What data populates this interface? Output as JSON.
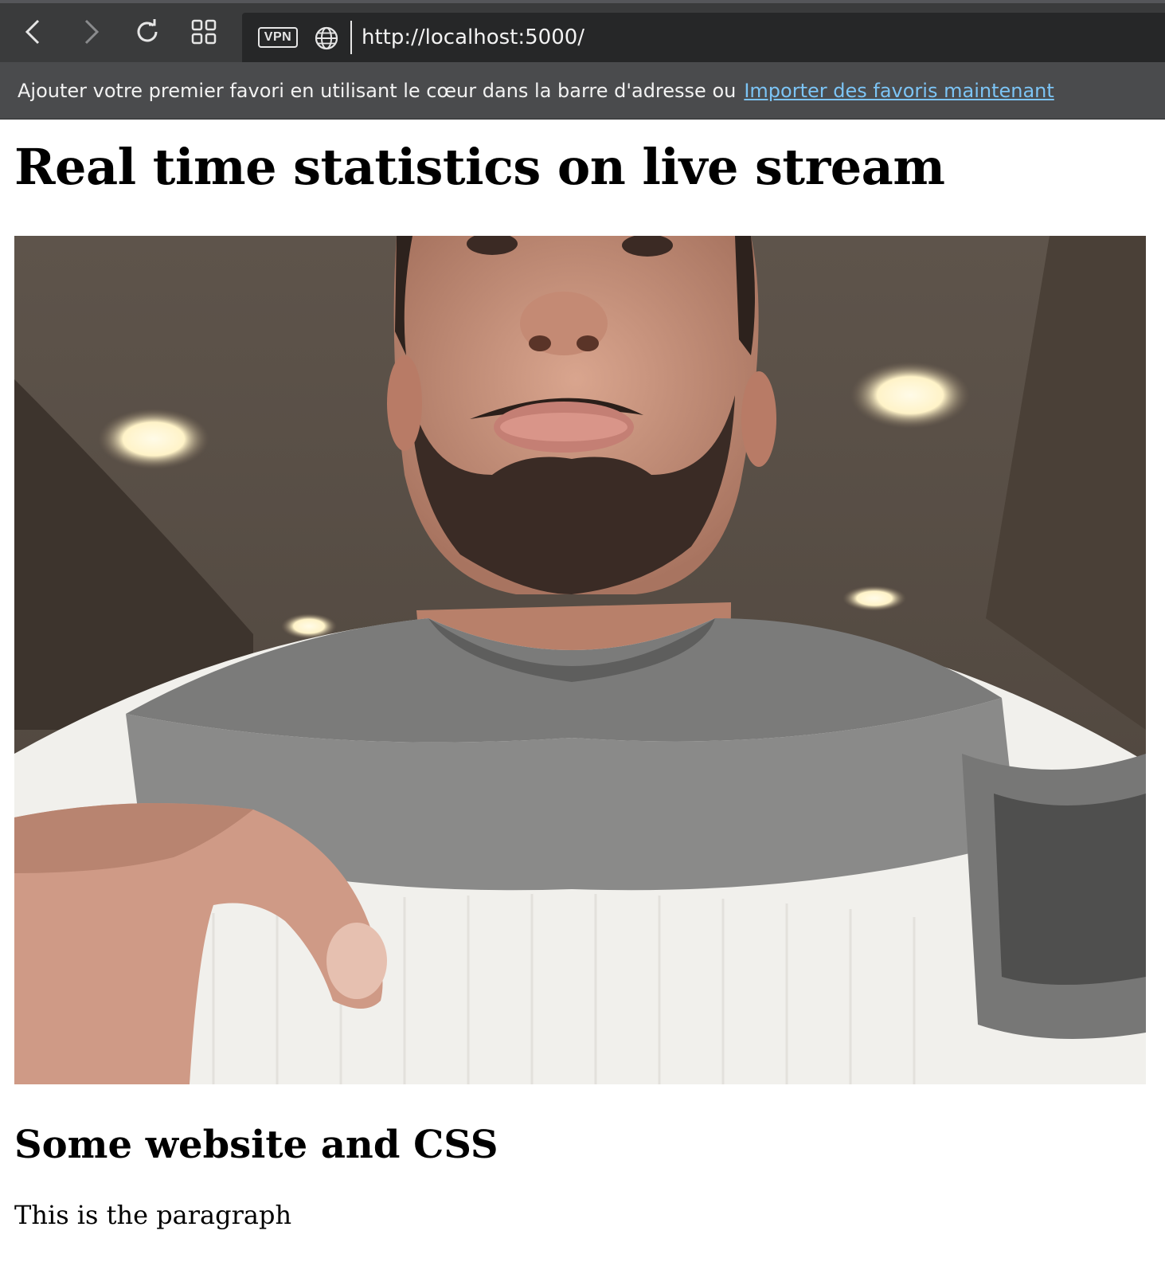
{
  "browser": {
    "vpn_label": "VPN",
    "url": "http://localhost:5000/",
    "bookmark_bar": {
      "message": "Ajouter votre premier favori en utilisant le cœur dans la barre d'adresse ou",
      "link_label": "Importer des favoris maintenant"
    },
    "icons": [
      "back-icon",
      "forward-icon",
      "reload-icon",
      "tabs-grid-icon",
      "globe-icon"
    ]
  },
  "page": {
    "title": "Real time statistics on live stream",
    "section_heading": "Some website and CSS",
    "paragraph": "This is the paragraph"
  },
  "colors": {
    "toolbar_bg": "#3a3b3c",
    "address_bg": "#262728",
    "bookmark_bar_bg": "#4a4b4d",
    "link_color": "#7cc4f5"
  }
}
